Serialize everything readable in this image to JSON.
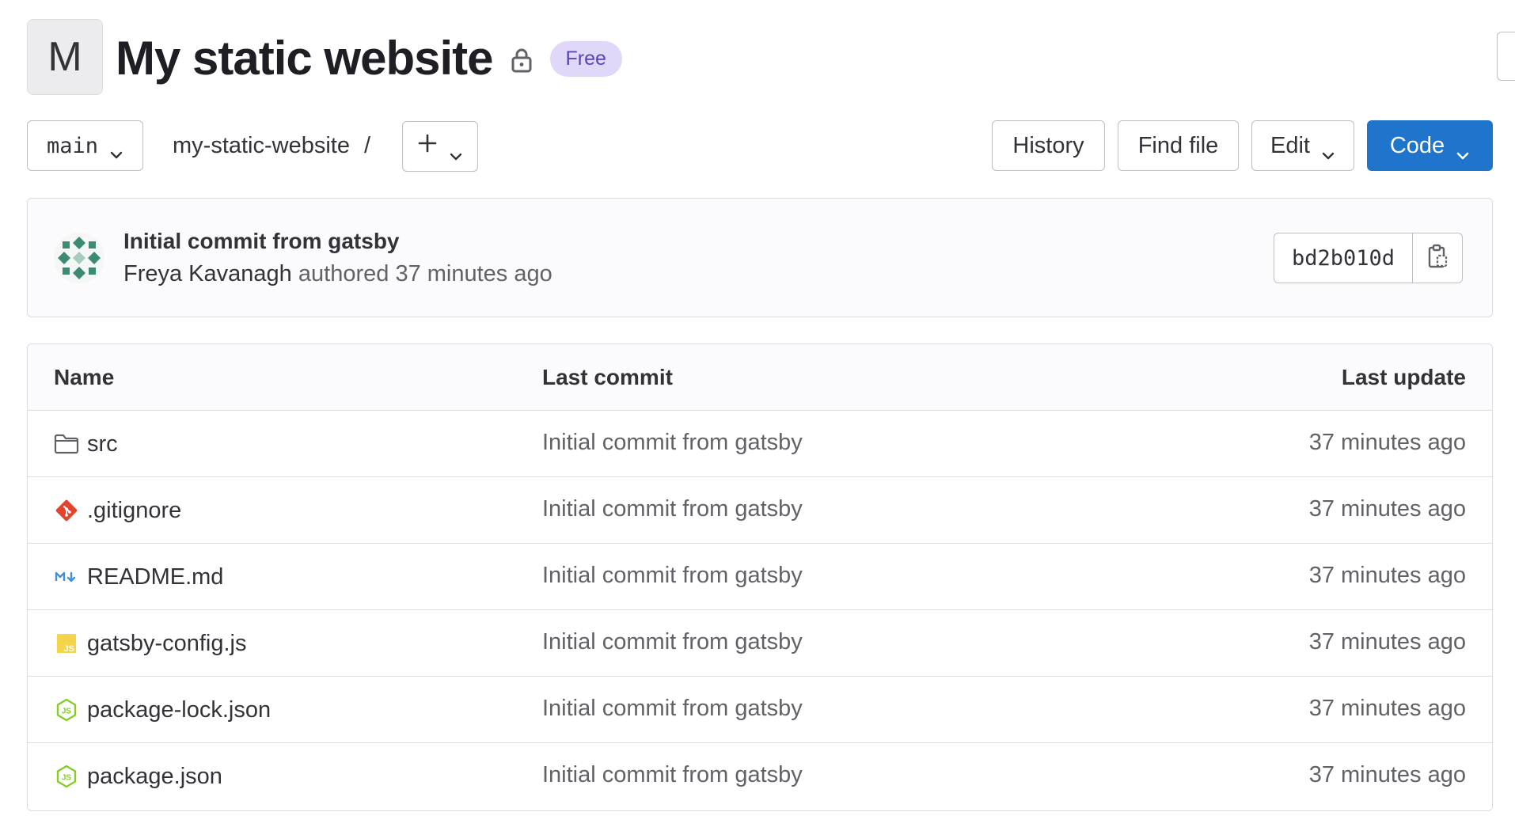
{
  "project": {
    "avatar_letter": "M",
    "title": "My static website",
    "badge": "Free"
  },
  "toolbar": {
    "branch": "main",
    "path": "my-static-website",
    "path_separator": "/",
    "history_label": "History",
    "find_file_label": "Find file",
    "edit_label": "Edit",
    "code_label": "Code"
  },
  "last_commit": {
    "message": "Initial commit from gatsby",
    "author": "Freya Kavanagh",
    "action": "authored",
    "time": "37 minutes ago",
    "sha": "bd2b010d"
  },
  "table": {
    "headers": {
      "name": "Name",
      "last_commit": "Last commit",
      "last_update": "Last update"
    },
    "rows": [
      {
        "name": "src",
        "icon": "folder-icon",
        "commit": "Initial commit from gatsby",
        "updated": "37 minutes ago"
      },
      {
        "name": ".gitignore",
        "icon": "git-icon",
        "commit": "Initial commit from gatsby",
        "updated": "37 minutes ago"
      },
      {
        "name": "README.md",
        "icon": "markdown-icon",
        "commit": "Initial commit from gatsby",
        "updated": "37 minutes ago"
      },
      {
        "name": "gatsby-config.js",
        "icon": "javascript-icon",
        "commit": "Initial commit from gatsby",
        "updated": "37 minutes ago"
      },
      {
        "name": "package-lock.json",
        "icon": "nodejs-icon",
        "commit": "Initial commit from gatsby",
        "updated": "37 minutes ago"
      },
      {
        "name": "package.json",
        "icon": "nodejs-icon",
        "commit": "Initial commit from gatsby",
        "updated": "37 minutes ago"
      }
    ]
  },
  "colors": {
    "primary_button": "#1f75cb",
    "badge_background": "#e1d8f9",
    "badge_text": "#5943b6",
    "git_icon": "#e24329",
    "js_icon": "#f5d34b",
    "node_icon": "#83cd29",
    "markdown_icon": "#428fdc"
  }
}
